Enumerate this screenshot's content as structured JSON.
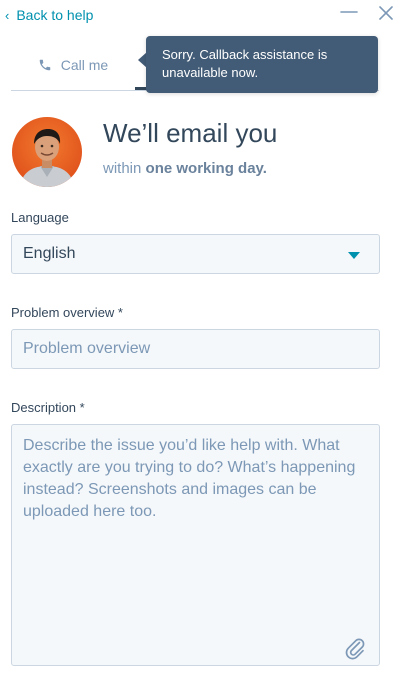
{
  "header": {
    "back_icon": "chevron-left-icon",
    "back_label": "Back to help",
    "minimize_icon": "minimize-icon",
    "close_icon": "close-icon",
    "link_color": "#0091ae"
  },
  "tabs": {
    "call_icon": "phone-icon",
    "call_label": "Call me"
  },
  "tooltip": {
    "text": "Sorry. Callback assistance is unavailable now.",
    "background": "#425b76"
  },
  "hero": {
    "avatar": "support-agent-avatar",
    "title": "We’ll email you",
    "subtitle_prefix": "within ",
    "subtitle_emphasis": "one working day."
  },
  "form": {
    "language": {
      "label": "Language",
      "selected": "English",
      "caret_icon": "caret-down-icon"
    },
    "problem_overview": {
      "label": "Problem overview *",
      "placeholder": "Problem overview",
      "value": ""
    },
    "description": {
      "label": "Description *",
      "placeholder": "Describe the issue you’d like help with. What exactly are you trying to do? What’s happening instead? Screenshots and images can be uploaded here too.",
      "value": "",
      "attach_icon": "paperclip-icon"
    }
  }
}
